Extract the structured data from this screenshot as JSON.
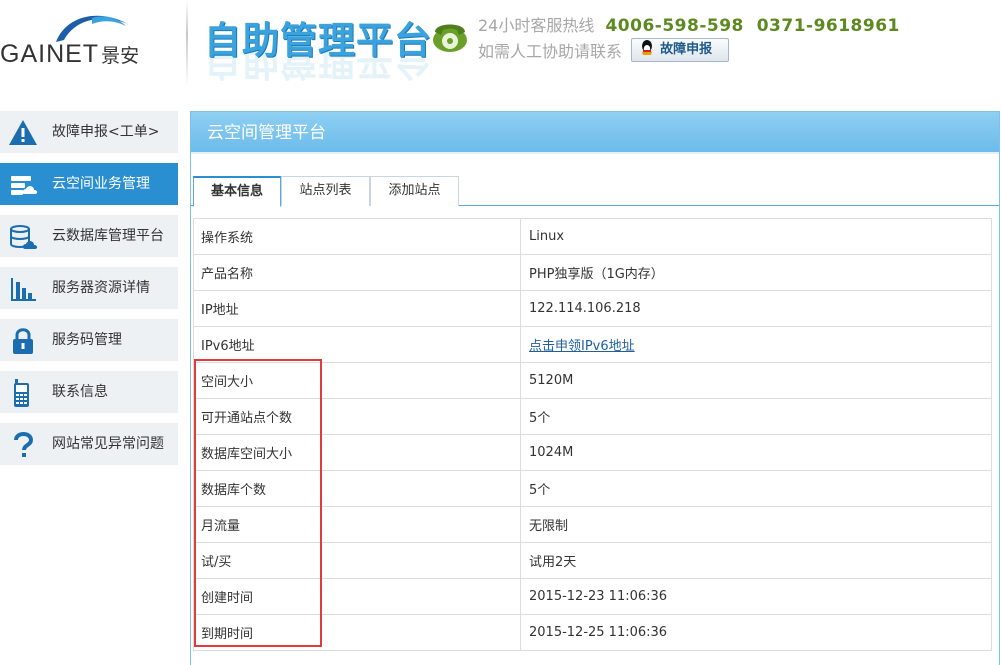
{
  "header": {
    "logo_text": "GAINET",
    "logo_cn": "景安",
    "platform_title": "自助管理平台",
    "hotline_label": "24小时客服热线",
    "hotline_numbers": "4006-598-598  0371-9618961",
    "assist_label": "如需人工协助请联系",
    "report_button": "故障申报",
    "icons": {
      "phone": "phone-icon",
      "qq": "qq-penguin-icon"
    },
    "colors": {
      "title": "#3aa3de",
      "hotline": "#5c8a20"
    }
  },
  "sidebar": {
    "items": [
      {
        "label": "故障申报<工单>",
        "icon": "warning-icon",
        "active": false
      },
      {
        "label": "云空间业务管理",
        "icon": "cloud-server-icon",
        "active": true
      },
      {
        "label": "云数据库管理平台",
        "icon": "cloud-database-icon",
        "active": false
      },
      {
        "label": "服务器资源详情",
        "icon": "bar-chart-icon",
        "active": false
      },
      {
        "label": "服务码管理",
        "icon": "lock-icon",
        "active": false
      },
      {
        "label": "联系信息",
        "icon": "mobile-phone-icon",
        "active": false
      },
      {
        "label": "网站常见异常问题",
        "icon": "question-icon",
        "active": false
      }
    ],
    "active_color": "#2a8fd0"
  },
  "main": {
    "title": "云空间管理平台",
    "tabs": [
      {
        "label": "基本信息",
        "active": true
      },
      {
        "label": "站点列表",
        "active": false
      },
      {
        "label": "添加站点",
        "active": false
      }
    ],
    "rows": [
      {
        "label": "操作系统",
        "value": "Linux"
      },
      {
        "label": "产品名称",
        "value": "PHP独享版（1G内存）"
      },
      {
        "label": "IP地址",
        "value": "122.114.106.218"
      },
      {
        "label": "IPv6地址",
        "value": "点击申领IPv6地址"
      },
      {
        "label": "空间大小",
        "value": "5120M"
      },
      {
        "label": "可开通站点个数",
        "value": "5个"
      },
      {
        "label": "数据库空间大小",
        "value": "1024M"
      },
      {
        "label": "数据库个数",
        "value": "5个"
      },
      {
        "label": "月流量",
        "value": "无限制"
      },
      {
        "label": "试/买",
        "value": "试用2天"
      },
      {
        "label": "创建时间",
        "value": "2015-12-23 11:06:36"
      },
      {
        "label": "到期时间",
        "value": "2015-12-25 11:06:36"
      }
    ],
    "trial_color": "#e00000",
    "highlight_color": "#e13b3b"
  }
}
